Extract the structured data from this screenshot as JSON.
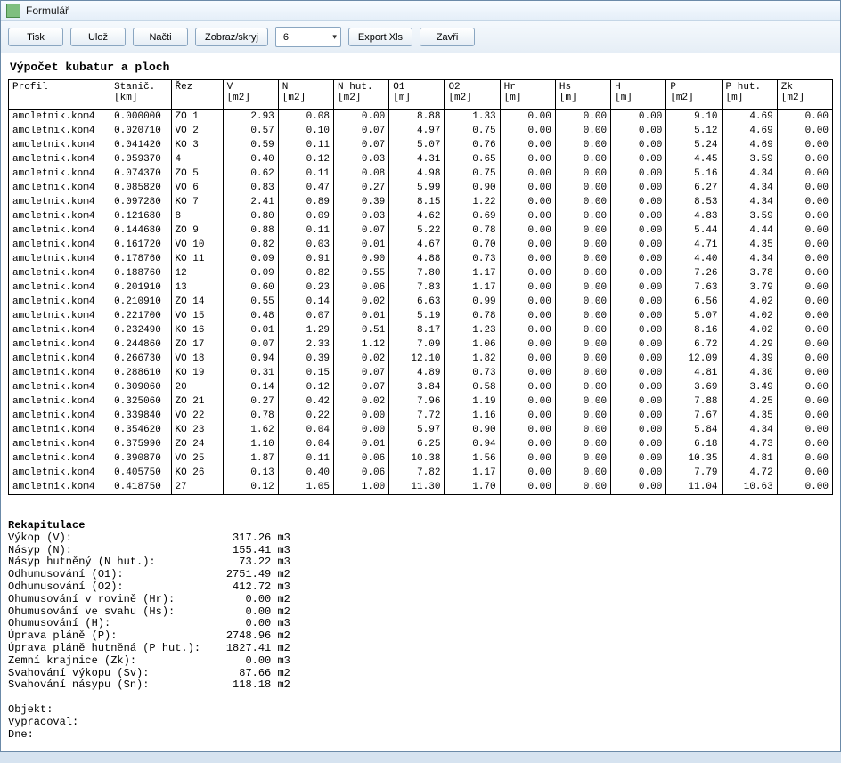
{
  "window": {
    "title": "Formulář"
  },
  "toolbar": {
    "tisk": "Tisk",
    "uloz": "Ulož",
    "nacti": "Načti",
    "zobraz": "Zobraz/skryj",
    "select_value": "6",
    "export": "Export Xls",
    "zavri": "Zavři"
  },
  "report": {
    "title": "Výpočet kubatur a ploch",
    "columns": [
      {
        "t": "Profil",
        "u": "",
        "align": "lft"
      },
      {
        "t": "Stanič.",
        "u": "[km]",
        "align": "lft"
      },
      {
        "t": "Řez",
        "u": "",
        "align": "lft"
      },
      {
        "t": "V",
        "u": "[m2]",
        "align": "num"
      },
      {
        "t": "N",
        "u": "[m2]",
        "align": "num"
      },
      {
        "t": "N hut.",
        "u": "[m2]",
        "align": "num"
      },
      {
        "t": "O1",
        "u": "[m]",
        "align": "num"
      },
      {
        "t": "O2",
        "u": "[m2]",
        "align": "num"
      },
      {
        "t": "Hr",
        "u": "[m]",
        "align": "num"
      },
      {
        "t": "Hs",
        "u": "[m]",
        "align": "num"
      },
      {
        "t": "H",
        "u": "[m]",
        "align": "num"
      },
      {
        "t": "P",
        "u": "[m2]",
        "align": "num"
      },
      {
        "t": "P hut.",
        "u": "[m]",
        "align": "num"
      },
      {
        "t": "Zk",
        "u": "[m2]",
        "align": "num"
      }
    ],
    "rows": [
      [
        "amoletnik.kom4",
        "0.000000",
        "ZO 1",
        "2.93",
        "0.08",
        "0.00",
        "8.88",
        "1.33",
        "0.00",
        "0.00",
        "0.00",
        "9.10",
        "4.69",
        "0.00"
      ],
      [
        "amoletnik.kom4",
        "0.020710",
        "VO 2",
        "0.57",
        "0.10",
        "0.07",
        "4.97",
        "0.75",
        "0.00",
        "0.00",
        "0.00",
        "5.12",
        "4.69",
        "0.00"
      ],
      [
        "amoletnik.kom4",
        "0.041420",
        "KO 3",
        "0.59",
        "0.11",
        "0.07",
        "5.07",
        "0.76",
        "0.00",
        "0.00",
        "0.00",
        "5.24",
        "4.69",
        "0.00"
      ],
      [
        "amoletnik.kom4",
        "0.059370",
        "4",
        "0.40",
        "0.12",
        "0.03",
        "4.31",
        "0.65",
        "0.00",
        "0.00",
        "0.00",
        "4.45",
        "3.59",
        "0.00"
      ],
      [
        "amoletnik.kom4",
        "0.074370",
        "ZO 5",
        "0.62",
        "0.11",
        "0.08",
        "4.98",
        "0.75",
        "0.00",
        "0.00",
        "0.00",
        "5.16",
        "4.34",
        "0.00"
      ],
      [
        "amoletnik.kom4",
        "0.085820",
        "VO 6",
        "0.83",
        "0.47",
        "0.27",
        "5.99",
        "0.90",
        "0.00",
        "0.00",
        "0.00",
        "6.27",
        "4.34",
        "0.00"
      ],
      [
        "amoletnik.kom4",
        "0.097280",
        "KO 7",
        "2.41",
        "0.89",
        "0.39",
        "8.15",
        "1.22",
        "0.00",
        "0.00",
        "0.00",
        "8.53",
        "4.34",
        "0.00"
      ],
      [
        "amoletnik.kom4",
        "0.121680",
        "8",
        "0.80",
        "0.09",
        "0.03",
        "4.62",
        "0.69",
        "0.00",
        "0.00",
        "0.00",
        "4.83",
        "3.59",
        "0.00"
      ],
      [
        "amoletnik.kom4",
        "0.144680",
        "ZO 9",
        "0.88",
        "0.11",
        "0.07",
        "5.22",
        "0.78",
        "0.00",
        "0.00",
        "0.00",
        "5.44",
        "4.44",
        "0.00"
      ],
      [
        "amoletnik.kom4",
        "0.161720",
        "VO 10",
        "0.82",
        "0.03",
        "0.01",
        "4.67",
        "0.70",
        "0.00",
        "0.00",
        "0.00",
        "4.71",
        "4.35",
        "0.00"
      ],
      [
        "amoletnik.kom4",
        "0.178760",
        "KO 11",
        "0.09",
        "0.91",
        "0.90",
        "4.88",
        "0.73",
        "0.00",
        "0.00",
        "0.00",
        "4.40",
        "4.34",
        "0.00"
      ],
      [
        "amoletnik.kom4",
        "0.188760",
        "12",
        "0.09",
        "0.82",
        "0.55",
        "7.80",
        "1.17",
        "0.00",
        "0.00",
        "0.00",
        "7.26",
        "3.78",
        "0.00"
      ],
      [
        "amoletnik.kom4",
        "0.201910",
        "13",
        "0.60",
        "0.23",
        "0.06",
        "7.83",
        "1.17",
        "0.00",
        "0.00",
        "0.00",
        "7.63",
        "3.79",
        "0.00"
      ],
      [
        "amoletnik.kom4",
        "0.210910",
        "ZO 14",
        "0.55",
        "0.14",
        "0.02",
        "6.63",
        "0.99",
        "0.00",
        "0.00",
        "0.00",
        "6.56",
        "4.02",
        "0.00"
      ],
      [
        "amoletnik.kom4",
        "0.221700",
        "VO 15",
        "0.48",
        "0.07",
        "0.01",
        "5.19",
        "0.78",
        "0.00",
        "0.00",
        "0.00",
        "5.07",
        "4.02",
        "0.00"
      ],
      [
        "amoletnik.kom4",
        "0.232490",
        "KO 16",
        "0.01",
        "1.29",
        "0.51",
        "8.17",
        "1.23",
        "0.00",
        "0.00",
        "0.00",
        "8.16",
        "4.02",
        "0.00"
      ],
      [
        "amoletnik.kom4",
        "0.244860",
        "ZO 17",
        "0.07",
        "2.33",
        "1.12",
        "7.09",
        "1.06",
        "0.00",
        "0.00",
        "0.00",
        "6.72",
        "4.29",
        "0.00"
      ],
      [
        "amoletnik.kom4",
        "0.266730",
        "VO 18",
        "0.94",
        "0.39",
        "0.02",
        "12.10",
        "1.82",
        "0.00",
        "0.00",
        "0.00",
        "12.09",
        "4.39",
        "0.00"
      ],
      [
        "amoletnik.kom4",
        "0.288610",
        "KO 19",
        "0.31",
        "0.15",
        "0.07",
        "4.89",
        "0.73",
        "0.00",
        "0.00",
        "0.00",
        "4.81",
        "4.30",
        "0.00"
      ],
      [
        "amoletnik.kom4",
        "0.309060",
        "20",
        "0.14",
        "0.12",
        "0.07",
        "3.84",
        "0.58",
        "0.00",
        "0.00",
        "0.00",
        "3.69",
        "3.49",
        "0.00"
      ],
      [
        "amoletnik.kom4",
        "0.325060",
        "ZO 21",
        "0.27",
        "0.42",
        "0.02",
        "7.96",
        "1.19",
        "0.00",
        "0.00",
        "0.00",
        "7.88",
        "4.25",
        "0.00"
      ],
      [
        "amoletnik.kom4",
        "0.339840",
        "VO 22",
        "0.78",
        "0.22",
        "0.00",
        "7.72",
        "1.16",
        "0.00",
        "0.00",
        "0.00",
        "7.67",
        "4.35",
        "0.00"
      ],
      [
        "amoletnik.kom4",
        "0.354620",
        "KO 23",
        "1.62",
        "0.04",
        "0.00",
        "5.97",
        "0.90",
        "0.00",
        "0.00",
        "0.00",
        "5.84",
        "4.34",
        "0.00"
      ],
      [
        "amoletnik.kom4",
        "0.375990",
        "ZO 24",
        "1.10",
        "0.04",
        "0.01",
        "6.25",
        "0.94",
        "0.00",
        "0.00",
        "0.00",
        "6.18",
        "4.73",
        "0.00"
      ],
      [
        "amoletnik.kom4",
        "0.390870",
        "VO 25",
        "1.87",
        "0.11",
        "0.06",
        "10.38",
        "1.56",
        "0.00",
        "0.00",
        "0.00",
        "10.35",
        "4.81",
        "0.00"
      ],
      [
        "amoletnik.kom4",
        "0.405750",
        "KO 26",
        "0.13",
        "0.40",
        "0.06",
        "7.82",
        "1.17",
        "0.00",
        "0.00",
        "0.00",
        "7.79",
        "4.72",
        "0.00"
      ],
      [
        "amoletnik.kom4",
        "0.418750",
        "27",
        "0.12",
        "1.05",
        "1.00",
        "11.30",
        "1.70",
        "0.00",
        "0.00",
        "0.00",
        "11.04",
        "10.63",
        "0.00"
      ]
    ],
    "recap": {
      "title": "Rekapitulace",
      "lines": [
        {
          "label": "Výkop (V):",
          "value": "317.26",
          "unit": "m3"
        },
        {
          "label": "Násyp (N):",
          "value": "155.41",
          "unit": "m3"
        },
        {
          "label": "Násyp hutněný (N hut.):",
          "value": "73.22",
          "unit": "m3"
        },
        {
          "label": "Odhumusování (O1):",
          "value": "2751.49",
          "unit": "m2"
        },
        {
          "label": "Odhumusování (O2):",
          "value": "412.72",
          "unit": "m3"
        },
        {
          "label": "Ohumusování v rovině (Hr):",
          "value": "0.00",
          "unit": "m2"
        },
        {
          "label": "Ohumusování ve svahu (Hs):",
          "value": "0.00",
          "unit": "m2"
        },
        {
          "label": "Ohumusování (H):",
          "value": "0.00",
          "unit": "m3"
        },
        {
          "label": "Úprava pláně (P):",
          "value": "2748.96",
          "unit": "m2"
        },
        {
          "label": "Úprava pláně hutněná (P hut.):",
          "value": "1827.41",
          "unit": "m2"
        },
        {
          "label": "Zemní krajnice (Zk):",
          "value": "0.00",
          "unit": "m3"
        },
        {
          "label": "Svahování výkopu (Sv):",
          "value": "87.66",
          "unit": "m2"
        },
        {
          "label": "Svahování násypu (Sn):",
          "value": "118.18",
          "unit": "m2"
        }
      ],
      "footer": [
        "Objekt:",
        "Vypracoval:",
        "Dne:"
      ]
    }
  }
}
